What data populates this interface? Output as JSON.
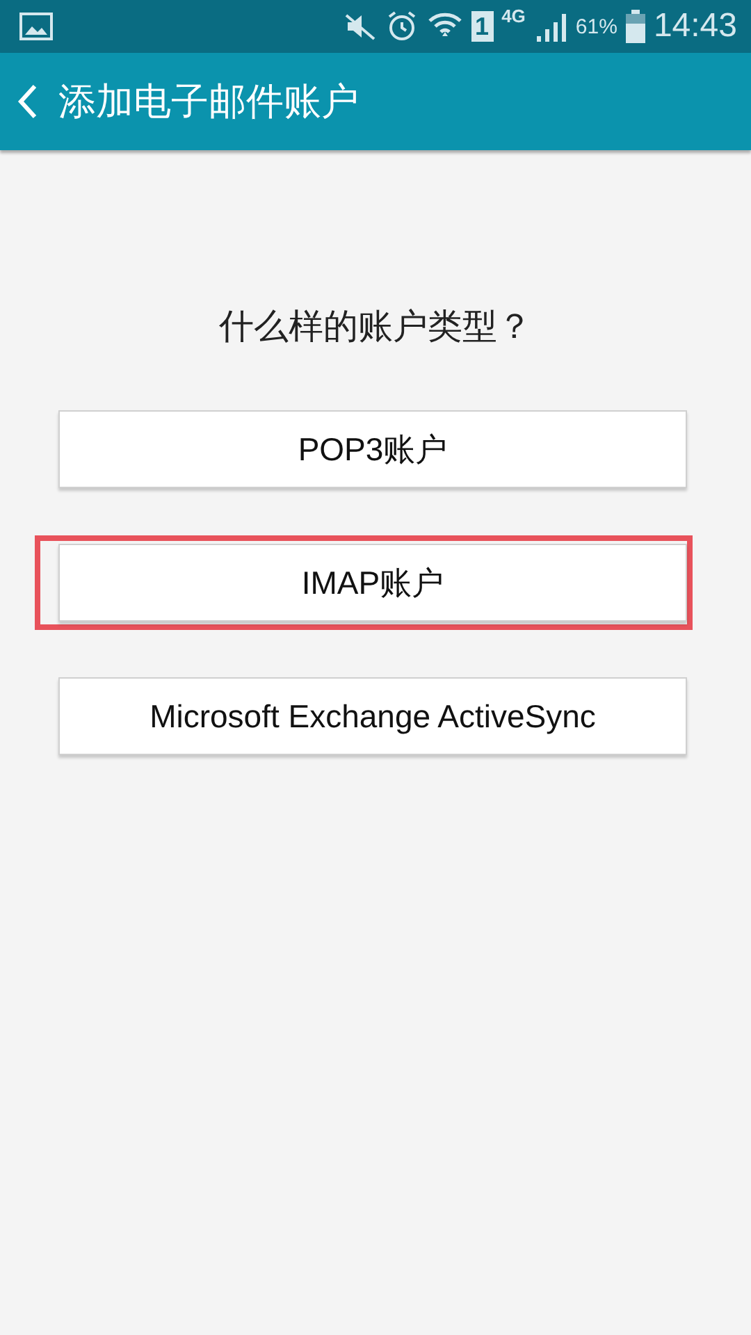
{
  "status_bar": {
    "sim": "1",
    "network": "4G",
    "battery": "61%",
    "time": "14:43"
  },
  "app_bar": {
    "title": "添加电子邮件账户"
  },
  "question": "什么样的账户类型？",
  "options": [
    {
      "label": "POP3账户",
      "highlighted": false
    },
    {
      "label": "IMAP账户",
      "highlighted": true
    },
    {
      "label": "Microsoft Exchange ActiveSync",
      "highlighted": false
    }
  ]
}
